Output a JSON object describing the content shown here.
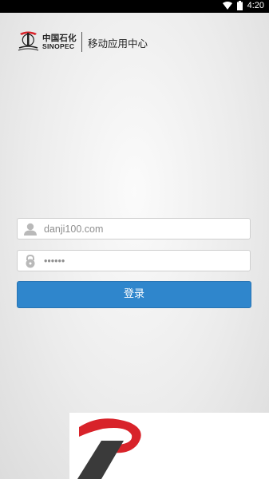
{
  "status_bar": {
    "time": "4:20"
  },
  "header": {
    "brand_cn": "中国石化",
    "brand_en": "SINOPEC",
    "app_title": "移动应用中心"
  },
  "login": {
    "username": {
      "value": "",
      "placeholder": "danji100.com"
    },
    "password": {
      "value": "",
      "placeholder": "••••••"
    },
    "submit_label": "登录"
  },
  "colors": {
    "accent": "#2f86cc",
    "brand_red": "#d8232a"
  }
}
